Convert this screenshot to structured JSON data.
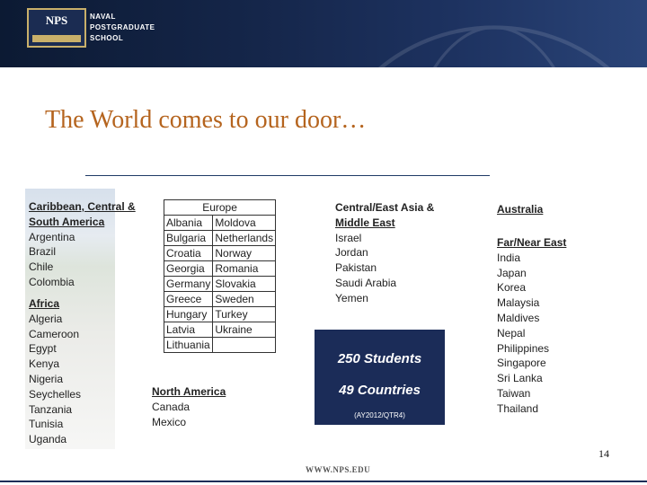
{
  "header": {
    "logo_text": "NPS",
    "school_lines": [
      "NAVAL",
      "POSTGRADUATE",
      "SCHOOL"
    ]
  },
  "title": "The World comes to our door…",
  "regions": {
    "caribbean": {
      "heading": [
        "Caribbean, Central &",
        "South America"
      ],
      "countries": [
        "Argentina",
        "Brazil",
        "Chile",
        "Colombia"
      ]
    },
    "africa": {
      "heading": "Africa",
      "countries": [
        "Algeria",
        "Cameroon",
        "Egypt",
        "Kenya",
        "Nigeria",
        "Seychelles",
        "Tanzania",
        "Tunisia",
        "Uganda"
      ]
    },
    "europe": {
      "heading": "Europe",
      "rows": [
        [
          "Albania",
          "Moldova"
        ],
        [
          "Bulgaria",
          "Netherlands"
        ],
        [
          "Croatia",
          "Norway"
        ],
        [
          "Georgia",
          "Romania"
        ],
        [
          "Germany",
          "Slovakia"
        ],
        [
          "Greece",
          "Sweden"
        ],
        [
          "Hungary",
          "Turkey"
        ],
        [
          "Latvia",
          "Ukraine"
        ],
        [
          "Lithuania",
          ""
        ]
      ]
    },
    "north_america": {
      "heading": "North America",
      "countries": [
        "Canada",
        "Mexico"
      ]
    },
    "central_east_asia": {
      "heading": [
        "Central/East Asia &",
        "Middle East"
      ],
      "countries": [
        "Israel",
        "Jordan",
        "Pakistan",
        "Saudi Arabia",
        "Yemen"
      ]
    },
    "australia": {
      "heading": "Australia"
    },
    "far_near_east": {
      "heading": "Far/Near East",
      "countries": [
        "India",
        "Japan",
        "Korea",
        "Malaysia",
        "Maldives",
        "Nepal",
        "Philippines",
        "Singapore",
        "Sri Lanka",
        "Taiwan",
        "Thailand"
      ]
    }
  },
  "stats": {
    "students": "250 Students",
    "countries": "49 Countries",
    "period": "(AY2012/QTR4)"
  },
  "page_number": "14",
  "footer": "WWW.NPS.EDU"
}
